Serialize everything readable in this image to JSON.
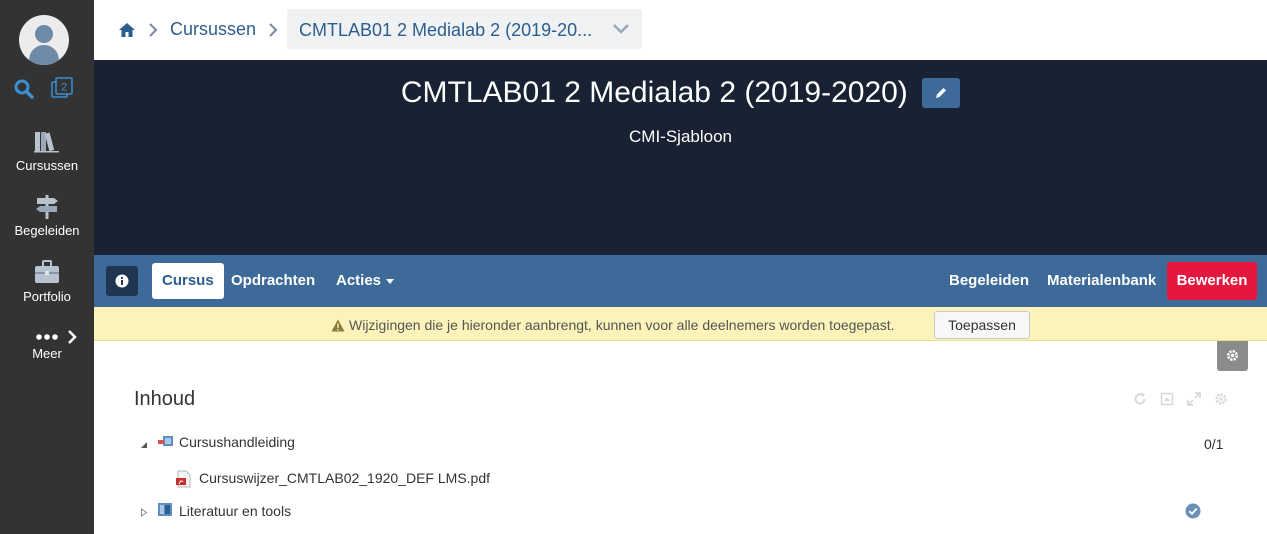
{
  "sidebar": {
    "search_icon": "search-icon",
    "badge_count": "2",
    "items": [
      {
        "label": "Cursussen",
        "icon": "books-icon"
      },
      {
        "label": "Begeleiden",
        "icon": "signpost-icon"
      },
      {
        "label": "Portfolio",
        "icon": "briefcase-icon"
      },
      {
        "label": "Meer",
        "icon": "more-dots-icon"
      }
    ]
  },
  "breadcrumb": {
    "home_icon": "home-icon",
    "link": "Cursussen",
    "current": "CMTLAB01 2 Medialab 2 (2019-20..."
  },
  "hero": {
    "title": "CMTLAB01 2 Medialab 2 (2019-2020)",
    "subtitle": "CMI-Sjabloon"
  },
  "course_nav": {
    "tabs": [
      "Cursus",
      "Opdrachten",
      "Acties"
    ],
    "right_links": [
      "Begeleiden",
      "Materialenbank"
    ],
    "edit_button": "Bewerken"
  },
  "warning": {
    "text": "Wijzigingen die je hieronder aanbrengt, kunnen voor alle deelnemers worden toegepast.",
    "button": "Toepassen"
  },
  "content": {
    "title": "Inhoud",
    "tree": [
      {
        "label": "Cursushandleiding",
        "status": "0/1",
        "expanded": true
      },
      {
        "label": "Cursuswijzer_CMTLAB02_1920_DEF LMS.pdf",
        "type": "pdf"
      },
      {
        "label": "Literatuur en tools",
        "status": "check",
        "expanded": false
      }
    ]
  },
  "colors": {
    "sidebar": "#333333",
    "hero": "#182233",
    "nav": "#3d6a99",
    "accent_red": "#e4173f",
    "warning_bg": "#fbf3b9"
  }
}
